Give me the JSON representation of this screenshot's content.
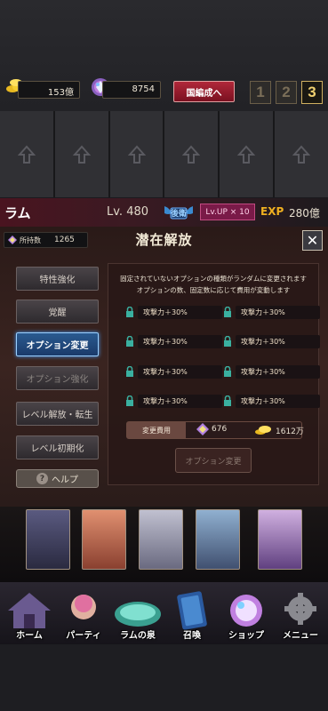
{
  "header": {
    "gold": "153億",
    "gems": "8754",
    "team_button": "国編成へ",
    "slots": [
      "1",
      "2",
      "3"
    ],
    "active_slot": "3"
  },
  "character": {
    "name": "ラム",
    "level": "Lv. 480",
    "rank": "後衛",
    "lvup": "Lv.UP × 10",
    "exp_label": "EXP",
    "exp_value": "280億"
  },
  "panel": {
    "owned_label": "所持数",
    "owned_value": "1265",
    "title": "潜在解放",
    "close": "✕",
    "menu": [
      {
        "label": "特性強化",
        "state": "normal"
      },
      {
        "label": "覚醒",
        "state": "normal"
      },
      {
        "label": "オプション変更",
        "state": "active"
      },
      {
        "label": "オプション強化",
        "state": "dim"
      },
      {
        "label": "レベル解放・転生",
        "state": "normal"
      },
      {
        "label": "レベル初期化",
        "state": "normal"
      }
    ],
    "help": "ヘルプ",
    "description_1": "固定されていないオプションの種類がランダムに変更されます",
    "description_2": "オプションの数、固定数に応じて費用が変動します",
    "options": [
      "攻撃力＋30%",
      "攻撃力＋30%",
      "攻撃力＋30%",
      "攻撃力＋30%",
      "攻撃力＋30%",
      "攻撃力＋30%",
      "攻撃力＋30%",
      "攻撃力＋30%"
    ],
    "cost_label": "変更費用",
    "cost_gems": "676",
    "cost_gold": "1612万",
    "change_button": "オプション変更"
  },
  "nav": {
    "items": [
      "ホーム",
      "パーティ",
      "ラムの泉",
      "召喚",
      "ショップ",
      "メニュー"
    ]
  },
  "colors": {
    "accent_blue": "#2a5a90",
    "team_red": "#b0283a",
    "exp_gold": "#f0b020"
  }
}
